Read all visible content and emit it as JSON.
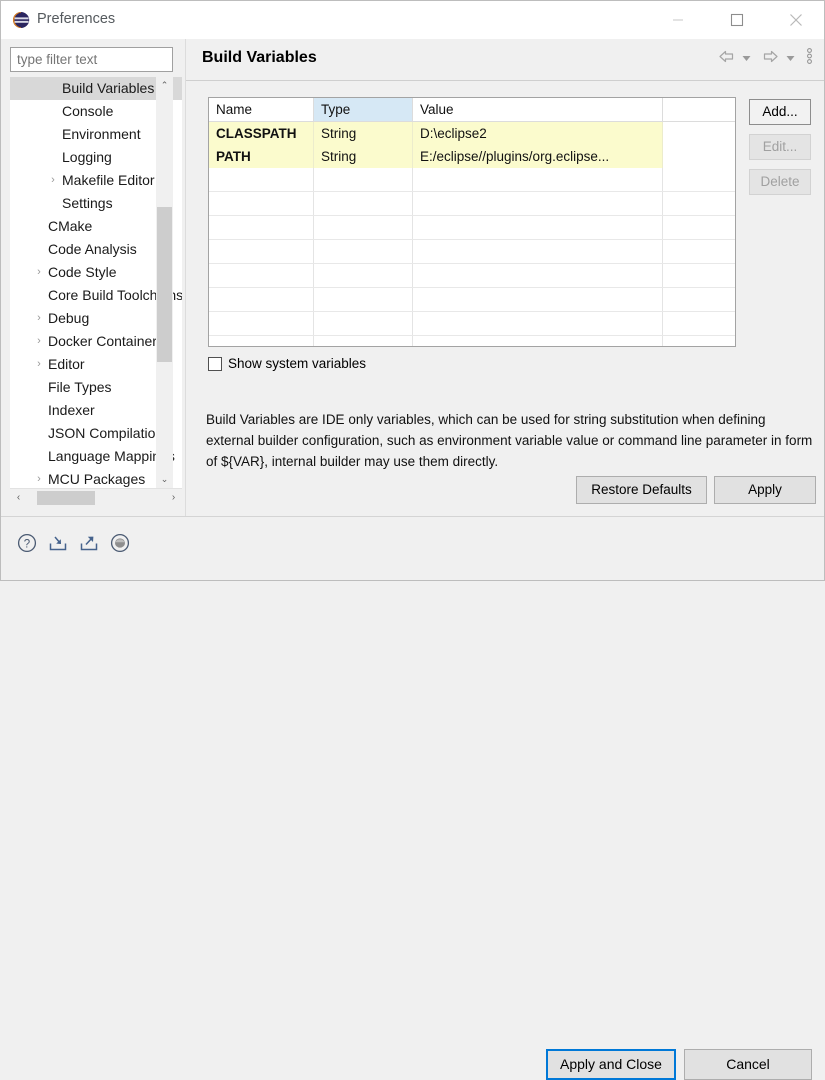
{
  "window": {
    "title": "Preferences",
    "icon": "eclipse-logo-icon",
    "minimize_label": "—",
    "maximize_label": "□",
    "close_label": "✕"
  },
  "filter": {
    "value": "",
    "placeholder": "type filter text"
  },
  "tree": {
    "items": [
      {
        "label": "Build Variables",
        "level": 1,
        "expandable": false,
        "selected": true
      },
      {
        "label": "Console",
        "level": 1,
        "expandable": false,
        "selected": false
      },
      {
        "label": "Environment",
        "level": 1,
        "expandable": false,
        "selected": false
      },
      {
        "label": "Logging",
        "level": 1,
        "expandable": false,
        "selected": false
      },
      {
        "label": "Makefile Editor",
        "level": 1,
        "expandable": true,
        "selected": false
      },
      {
        "label": "Settings",
        "level": 1,
        "expandable": false,
        "selected": false
      },
      {
        "label": "CMake",
        "level": 0,
        "expandable": false,
        "selected": false
      },
      {
        "label": "Code Analysis",
        "level": 0,
        "expandable": false,
        "selected": false
      },
      {
        "label": "Code Style",
        "level": 0,
        "expandable": true,
        "selected": false
      },
      {
        "label": "Core Build Toolchains",
        "level": 0,
        "expandable": false,
        "selected": false
      },
      {
        "label": "Debug",
        "level": 0,
        "expandable": true,
        "selected": false
      },
      {
        "label": "Docker Container",
        "level": 0,
        "expandable": true,
        "selected": false
      },
      {
        "label": "Editor",
        "level": 0,
        "expandable": true,
        "selected": false
      },
      {
        "label": "File Types",
        "level": 0,
        "expandable": false,
        "selected": false
      },
      {
        "label": "Indexer",
        "level": 0,
        "expandable": false,
        "selected": false
      },
      {
        "label": "JSON Compilation",
        "level": 0,
        "expandable": false,
        "selected": false
      },
      {
        "label": "Language Mappings",
        "level": 0,
        "expandable": false,
        "selected": false
      },
      {
        "label": "MCU Packages",
        "level": 0,
        "expandable": true,
        "selected": false
      }
    ],
    "scroll_up_glyph": "⌃",
    "scroll_down_glyph": "⌄",
    "scroll_left_glyph": "‹",
    "scroll_right_glyph": "›",
    "expand_glyph": "›"
  },
  "page": {
    "title": "Build Variables",
    "nav": {
      "back_icon": "back-arrow-icon",
      "back_menu_icon": "chevron-down-icon",
      "forward_icon": "forward-arrow-icon",
      "forward_menu_icon": "chevron-down-icon",
      "overflow_icon": "vertical-dots-menu-icon"
    }
  },
  "table": {
    "columns": [
      "Name",
      "Type",
      "Value",
      ""
    ],
    "selected_column": "Type",
    "rows": [
      {
        "name": "CLASSPATH",
        "type": "String",
        "value": "D:\\eclipse2"
      },
      {
        "name": "PATH",
        "type": "String",
        "value": "E:/eclipse//plugins/org.eclipse..."
      }
    ],
    "empty_row_count": 8
  },
  "side_buttons": [
    {
      "label": "Add...",
      "enabled": true
    },
    {
      "label": "Edit...",
      "enabled": false
    },
    {
      "label": "Delete",
      "enabled": false
    }
  ],
  "checkbox": {
    "label": "Show system variables",
    "checked": false
  },
  "description": "Build Variables are IDE only variables, which can be used for string substitution when defining external builder configuration, such as environment variable value or command line parameter in form of ${VAR}, internal builder may use them directly.",
  "page_buttons": {
    "restore_defaults": "Restore Defaults",
    "apply": "Apply"
  },
  "footer": {
    "icons": [
      {
        "name": "help-icon",
        "label": "?"
      },
      {
        "name": "import-icon",
        "label": ""
      },
      {
        "name": "export-icon",
        "label": ""
      },
      {
        "name": "record-icon",
        "label": ""
      }
    ],
    "apply_and_close": "Apply and Close",
    "cancel": "Cancel"
  },
  "colors": {
    "accent": "#0078d7",
    "row_highlight": "#fbfbcd",
    "column_highlight": "#d6e8f5",
    "window_bg": "#f0f0f0"
  }
}
